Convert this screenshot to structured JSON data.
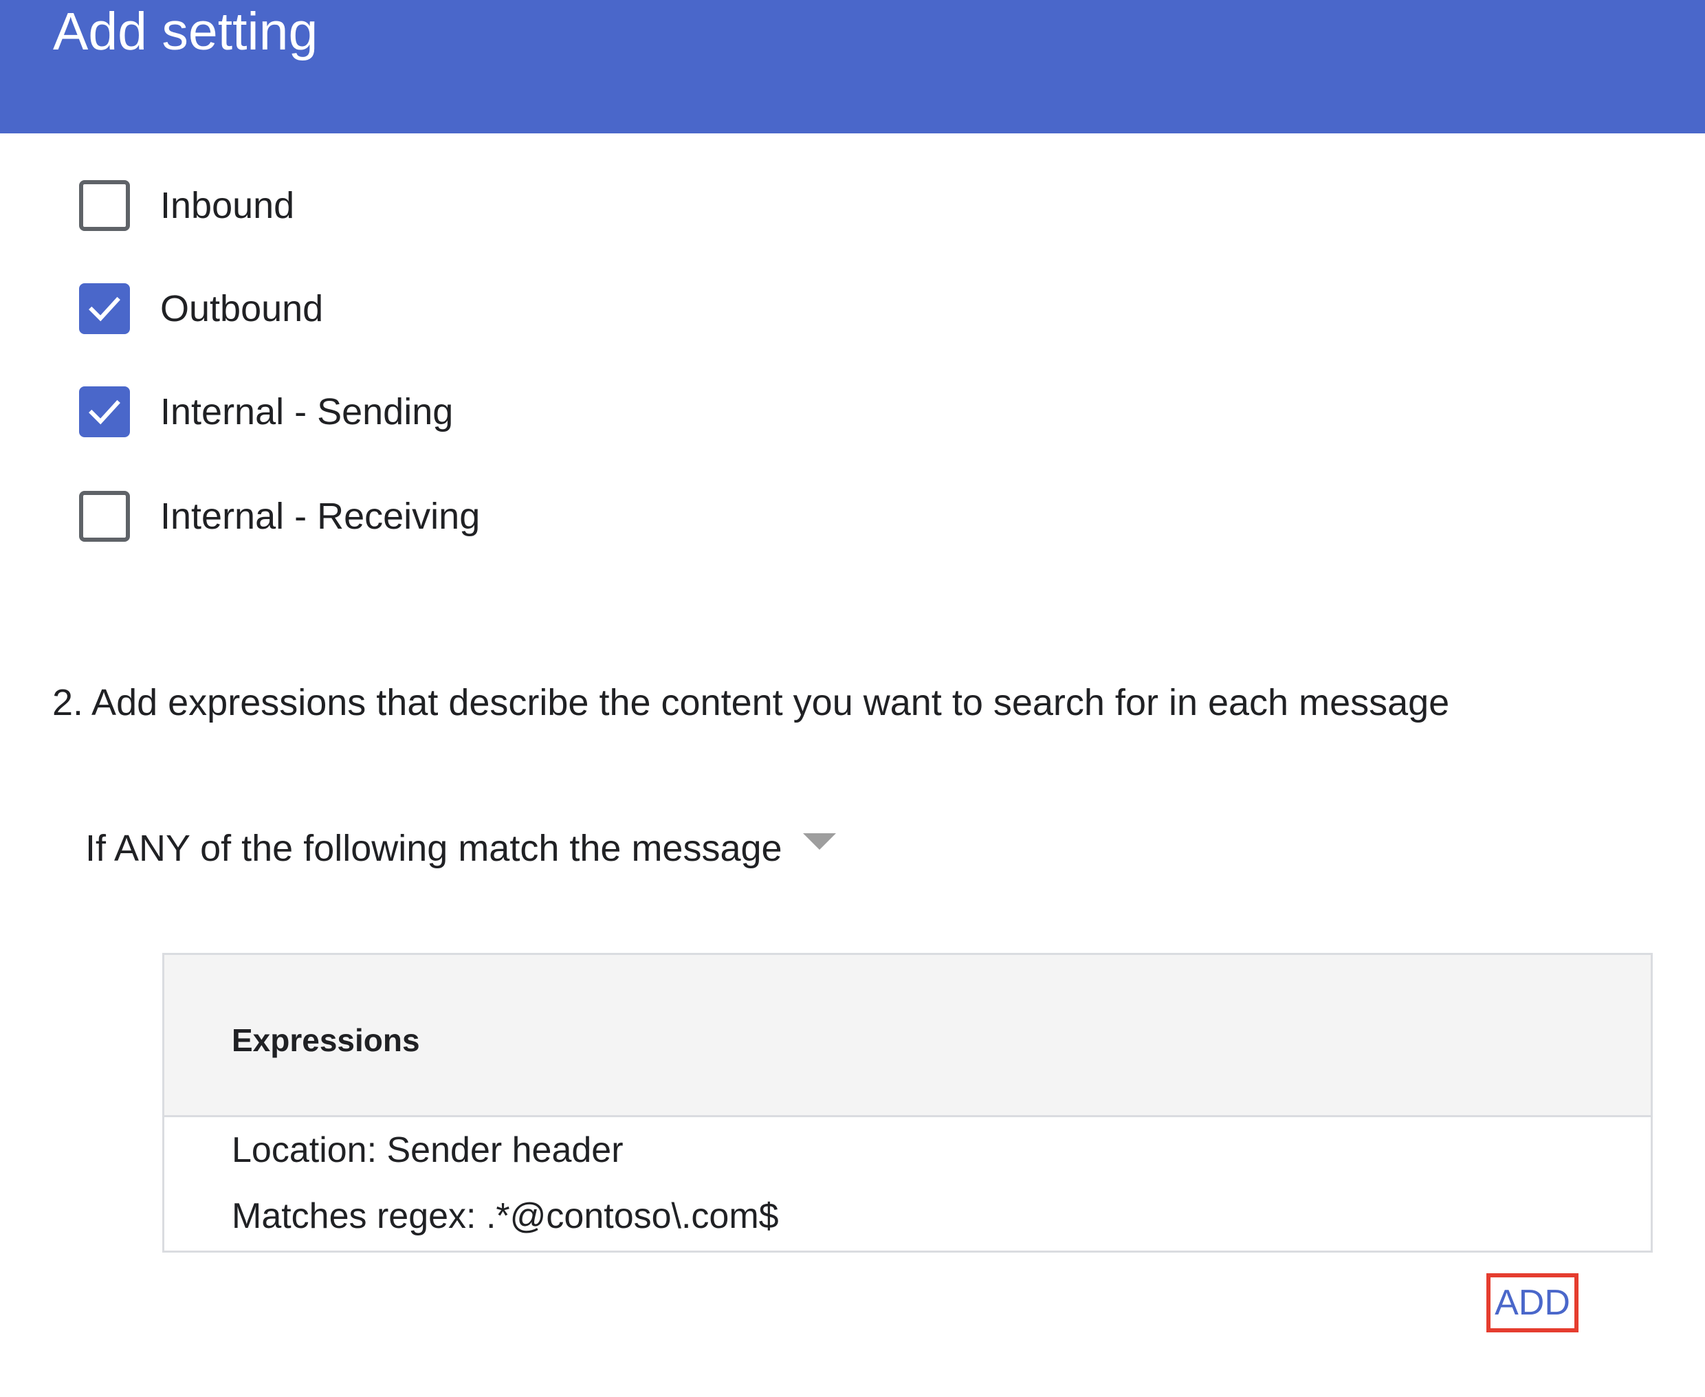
{
  "header": {
    "title": "Add setting"
  },
  "checkboxes": [
    {
      "label": "Inbound",
      "checked": false
    },
    {
      "label": "Outbound",
      "checked": true
    },
    {
      "label": "Internal - Sending",
      "checked": true
    },
    {
      "label": "Internal - Receiving",
      "checked": false
    }
  ],
  "section": {
    "heading": "2. Add expressions that describe the content you want to search for in each message"
  },
  "match": {
    "selected": "If ANY of the following match the message"
  },
  "expressions": {
    "header": "Expressions",
    "items": [
      {
        "location": "Location: Sender header",
        "rule": "Matches regex: .*@contoso\\.com$"
      }
    ]
  },
  "actions": {
    "add_label": "ADD"
  },
  "colors": {
    "accent": "#4a67ca",
    "highlight_border": "#e53d2f"
  },
  "icons": {
    "checked": "check-icon",
    "dropdown": "chevron-down-icon"
  }
}
